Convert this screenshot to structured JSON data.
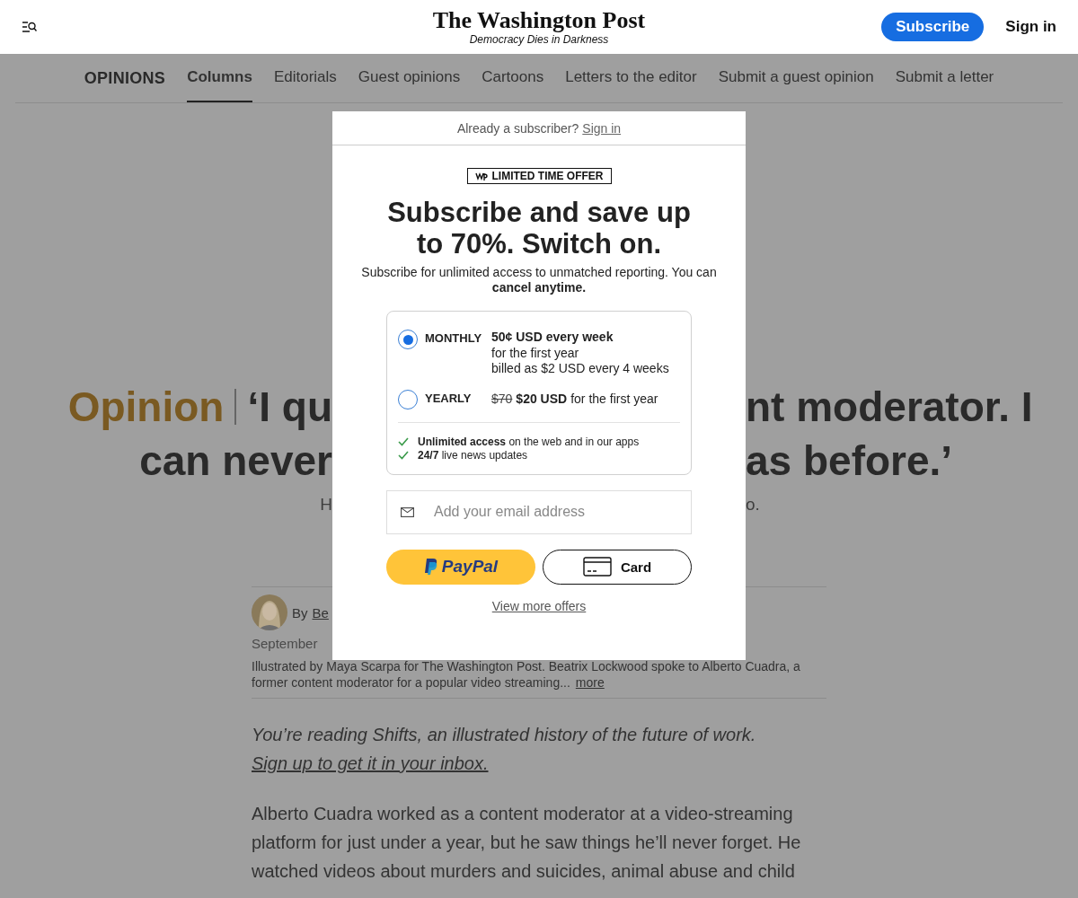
{
  "header": {
    "logo": "The Washington Post",
    "tagline": "Democracy Dies in Darkness",
    "subscribe": "Subscribe",
    "sign_in": "Sign in"
  },
  "nav": {
    "section": "OPINIONS",
    "items": [
      {
        "label": "Columns",
        "selected": true
      },
      {
        "label": "Editorials",
        "selected": false
      },
      {
        "label": "Guest opinions",
        "selected": false
      },
      {
        "label": "Cartoons",
        "selected": false
      },
      {
        "label": "Letters to the editor",
        "selected": false
      },
      {
        "label": "Submit a guest opinion",
        "selected": false
      },
      {
        "label": "Submit a letter",
        "selected": false
      }
    ]
  },
  "headline": {
    "label": "Opinion",
    "lines": [
      {
        "left": "‘I qu",
        "right": "nt moderator. I"
      },
      {
        "left": "can never",
        "right": "as before.’"
      }
    ]
  },
  "subhead": {
    "left": "H",
    "right": "o."
  },
  "byline": {
    "prefix": "By",
    "author": "Be",
    "date": "September",
    "caption": "Illustrated by Maya Scarpa for The Washington Post. Beatrix Lockwood spoke to Alberto Cuadra, a former content moderator for a popular video streaming...",
    "more": "more"
  },
  "intro": {
    "text": "You’re reading Shifts, an illustrated history of the future of work.",
    "link": "Sign up to get it in your inbox."
  },
  "body": "Alberto Cuadra worked as a content moderator at a video-streaming platform for just under a year, but he saw things he’ll never forget. He watched videos about murders and suicides, animal abuse and child",
  "modal": {
    "already": "Already a subscriber?",
    "sign_in": "Sign in",
    "badge": "LIMITED TIME OFFER",
    "title": "Subscribe and save up to 70%. Switch on.",
    "description": "Subscribe for unlimited access to unmatched reporting. You can **cancel anytime.**",
    "plans": [
      {
        "name": "MONTHLY",
        "selected": true,
        "price": "50¢ USD every week",
        "details": [
          "for the first year",
          "billed as $2 USD every 4 weeks"
        ]
      },
      {
        "name": "YEARLY",
        "selected": false,
        "old_price": "$70",
        "price": "$20 USD",
        "note": "for the first year"
      }
    ],
    "features": [
      "**Unlimited access** on the web and in our apps",
      "**24/7** live news updates"
    ],
    "email": {
      "placeholder": "Add your email address"
    },
    "paypal": "PayPal",
    "card": "Card",
    "more_offers": "View more offers"
  }
}
